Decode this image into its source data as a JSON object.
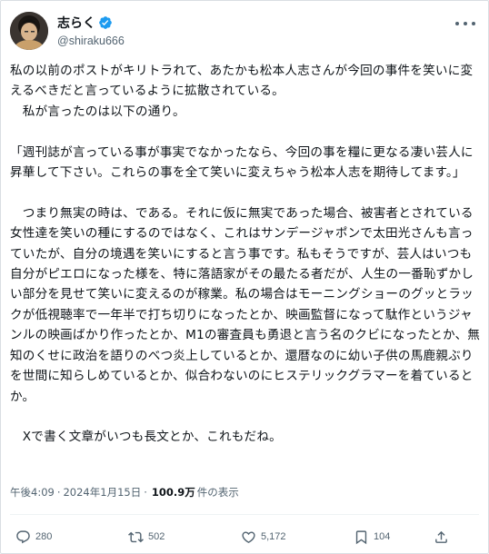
{
  "author": {
    "display_name": "志らく",
    "handle": "@shiraku666",
    "verified_badge_icon": "verified-badge-icon"
  },
  "post": {
    "text": "私の以前のポストがキリトラれて、あたかも松本人志さんが今回の事件を笑いに変えるべきだと言っているように拡散されている。\n　私が言ったのは以下の通り。\n\n「週刊誌が言っている事が事実でなかったなら、今回の事を糧に更なる凄い芸人に昇華して下さい。これらの事を全て笑いに変えちゃう松本人志を期待してます。」\n\n　つまり無実の時は、である。それに仮に無実であった場合、被害者とされている女性達を笑いの種にするのではなく、これはサンデージャポンで太田光さんも言っていたが、自分の境遇を笑いにすると言う事です。私もそうですが、芸人はいつも自分がピエロになった様を、特に落語家がその最たる者だが、人生の一番恥ずかしい部分を見せて笑いに変えるのが稼業。私の場合はモーニングショーのグッとラックが低視聴率で一年半で打ち切りになったとか、映画監督になって駄作というジャンルの映画ばかり作ったとか、M1の審査員も勇退と言う名のクビになったとか、無知のくせに政治を語りのべつ炎上しているとか、還暦なのに幼い子供の馬鹿親ぶりを世間に知らしめているとか、似合わないのにヒステリックグラマーを着ているとか。\n\n　Xで書く文章がいつも長文とか、これもだね。"
  },
  "meta": {
    "time": "午後4:09",
    "separator": "·",
    "date": "2024年1月15日",
    "views": "100.9万",
    "views_label": "件の表示"
  },
  "actions": {
    "replies": "280",
    "reposts": "502",
    "likes": "5,172",
    "bookmarks": "104"
  },
  "colors": {
    "text": "#0f1419",
    "secondary": "#536471",
    "verified": "#1d9bf0",
    "divider": "#eff3f4"
  }
}
